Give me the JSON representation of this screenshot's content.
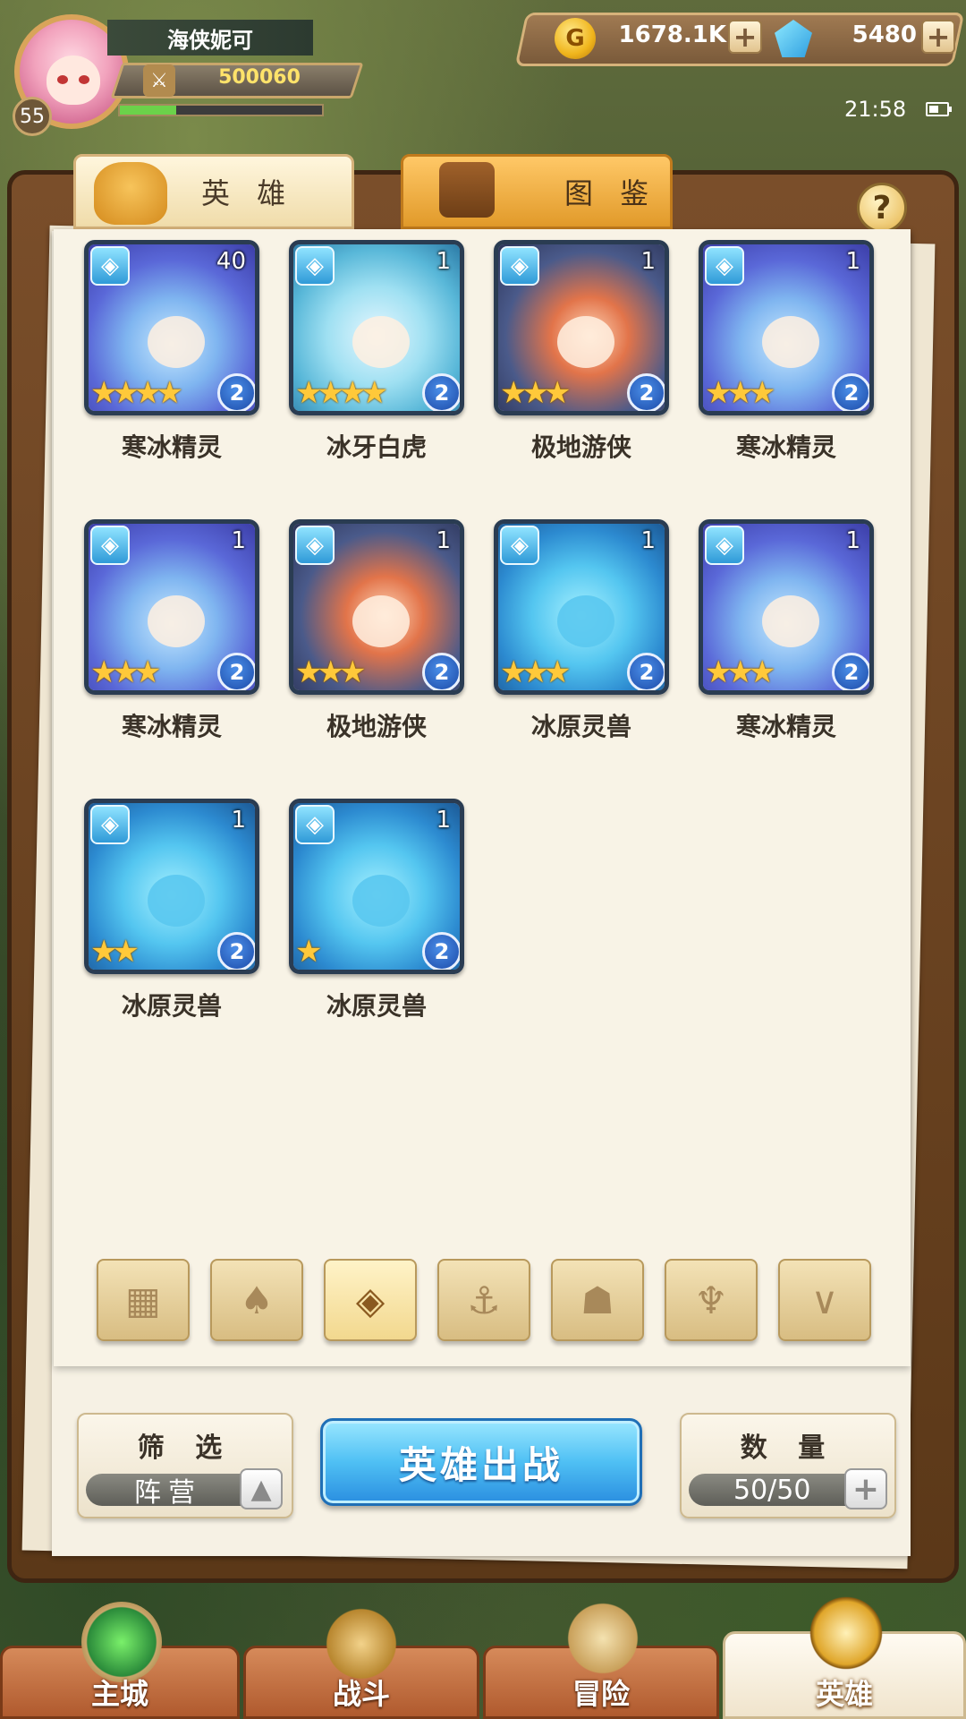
{
  "player": {
    "name": "海侠妮可",
    "level": "55",
    "power": "500060",
    "exp_progress": 0.28
  },
  "resources": {
    "gold": "1678.1K",
    "diamonds": "5480",
    "plus_symbol": "+"
  },
  "status": {
    "time": "21:58"
  },
  "tabs": [
    {
      "label": "英 雄",
      "icon": "knight-helmet-icon",
      "active": true
    },
    {
      "label": "图 鉴",
      "icon": "magnifier-book-icon",
      "active": false
    }
  ],
  "help_label": "?",
  "heroes": [
    {
      "name": "寒冰精灵",
      "count": "40",
      "stars": "★★★★",
      "grade": "2",
      "portrait": "frost"
    },
    {
      "name": "冰牙白虎",
      "count": "1",
      "stars": "★★★★",
      "grade": "2",
      "portrait": "tiger"
    },
    {
      "name": "极地游侠",
      "count": "1",
      "stars": "★★★",
      "grade": "2",
      "portrait": "ranger"
    },
    {
      "name": "寒冰精灵",
      "count": "1",
      "stars": "★★★",
      "grade": "2",
      "portrait": "frost"
    },
    {
      "name": "寒冰精灵",
      "count": "1",
      "stars": "★★★",
      "grade": "2",
      "portrait": "frost"
    },
    {
      "name": "极地游侠",
      "count": "1",
      "stars": "★★★",
      "grade": "2",
      "portrait": "ranger"
    },
    {
      "name": "冰原灵兽",
      "count": "1",
      "stars": "★★★",
      "grade": "2",
      "portrait": "beast"
    },
    {
      "name": "寒冰精灵",
      "count": "1",
      "stars": "★★★",
      "grade": "2",
      "portrait": "frost"
    },
    {
      "name": "冰原灵兽",
      "count": "1",
      "stars": "★★",
      "grade": "2",
      "portrait": "beast"
    },
    {
      "name": "冰原灵兽",
      "count": "1",
      "stars": "★",
      "grade": "2",
      "portrait": "beast"
    }
  ],
  "faction_filters": [
    {
      "icon": "grid-all-icon",
      "glyph": "▦",
      "active": false
    },
    {
      "icon": "flame-faction-icon",
      "glyph": "♠",
      "active": false
    },
    {
      "icon": "ice-faction-icon",
      "glyph": "◈",
      "active": true
    },
    {
      "icon": "anchor-faction-icon",
      "glyph": "⚓",
      "active": false
    },
    {
      "icon": "beast-faction-icon",
      "glyph": "☗",
      "active": false
    },
    {
      "icon": "demon-faction-icon",
      "glyph": "♆",
      "active": false
    },
    {
      "icon": "wing-faction-icon",
      "glyph": "∨",
      "active": false
    }
  ],
  "filter_box": {
    "title": "筛 选",
    "value": "阵营",
    "toggle_glyph": "▲"
  },
  "deploy_button": "英雄出战",
  "quantity_box": {
    "title": "数 量",
    "value": "50/50",
    "plus_glyph": "+"
  },
  "nav": [
    {
      "label": "主城",
      "icon": "castle-crest-icon",
      "active": false
    },
    {
      "label": "战斗",
      "icon": "crossed-swords-icon",
      "active": false
    },
    {
      "label": "冒险",
      "icon": "scroll-map-icon",
      "active": false
    },
    {
      "label": "英雄",
      "icon": "golden-helmet-icon",
      "active": true
    }
  ],
  "colors": {
    "accent_blue": "#4fc0f4",
    "gold_text": "#ffe36a",
    "star_gold": "#ffc93a",
    "wood_frame": "#6a4220",
    "paper": "#f8f3e6"
  }
}
